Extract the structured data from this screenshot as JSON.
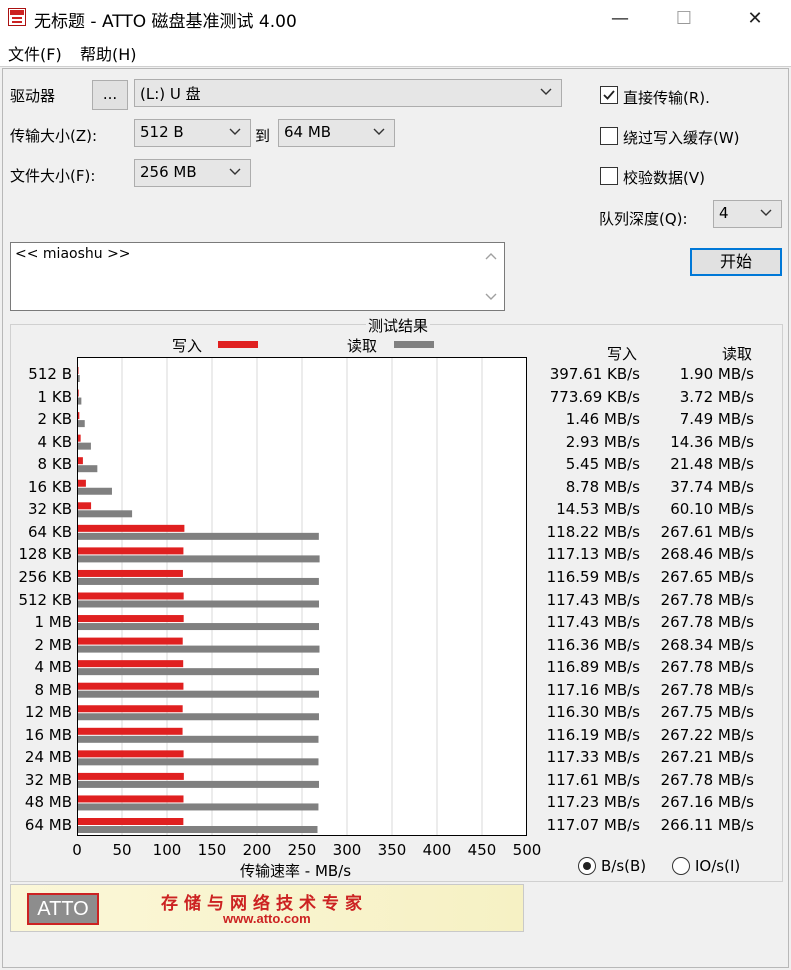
{
  "window": {
    "title": "无标题 - ATTO 磁盘基准测试 4.00",
    "minimize_glyph": "—",
    "maximize_glyph": "☐",
    "close_glyph": "✕"
  },
  "menu": {
    "file": "文件(F)",
    "help": "帮助(H)"
  },
  "drive": {
    "label": "驱动器",
    "browse_label": "...",
    "value": "(L:) U 盘"
  },
  "transfer": {
    "label": "传输大小(Z):",
    "from": "512 B",
    "to_label": "到",
    "to": "64 MB"
  },
  "filesize": {
    "label": "文件大小(F):",
    "value": "256 MB"
  },
  "options": {
    "direct": {
      "label": "直接传输(R).",
      "checked": true
    },
    "bypass": {
      "label": "绕过写入缓存(W)",
      "checked": false
    },
    "verify": {
      "label": "校验数据(V)",
      "checked": false
    },
    "queue_label": "队列深度(Q):",
    "queue_value": "4"
  },
  "start_button": "开始",
  "description": "<< miaoshu >>",
  "results": {
    "title": "测试结果",
    "legend_write": "写入",
    "legend_read": "读取",
    "col_write": "写入",
    "col_read": "读取",
    "units": {
      "bytes": "B/s(B)",
      "io": "IO/s(I)",
      "selected": "bytes"
    }
  },
  "chart_data": {
    "type": "bar",
    "orientation": "horizontal",
    "title": "测试结果",
    "xlabel": "传输速率 - MB/s",
    "ylabel": "",
    "xlim": [
      0,
      500
    ],
    "xticks": [
      0,
      50,
      100,
      150,
      200,
      250,
      300,
      350,
      400,
      450,
      500
    ],
    "grid": true,
    "legend": "top",
    "categories": [
      "512 B",
      "1 KB",
      "2 KB",
      "4 KB",
      "8 KB",
      "16 KB",
      "32 KB",
      "64 KB",
      "128 KB",
      "256 KB",
      "512 KB",
      "1 MB",
      "2 MB",
      "4 MB",
      "8 MB",
      "12 MB",
      "16 MB",
      "24 MB",
      "32 MB",
      "48 MB",
      "64 MB"
    ],
    "series": [
      {
        "name": "写入",
        "color": "#e02020",
        "values": [
          0.39,
          0.76,
          1.46,
          2.93,
          5.45,
          8.78,
          14.53,
          118.22,
          117.13,
          116.59,
          117.43,
          117.43,
          116.36,
          116.89,
          117.16,
          116.3,
          116.19,
          117.33,
          117.61,
          117.23,
          117.07
        ],
        "labels": [
          "397.61 KB/s",
          "773.69 KB/s",
          "1.46 MB/s",
          "2.93 MB/s",
          "5.45 MB/s",
          "8.78 MB/s",
          "14.53 MB/s",
          "118.22 MB/s",
          "117.13 MB/s",
          "116.59 MB/s",
          "117.43 MB/s",
          "117.43 MB/s",
          "116.36 MB/s",
          "116.89 MB/s",
          "117.16 MB/s",
          "116.30 MB/s",
          "116.19 MB/s",
          "117.33 MB/s",
          "117.61 MB/s",
          "117.23 MB/s",
          "117.07 MB/s"
        ]
      },
      {
        "name": "读取",
        "color": "#808080",
        "values": [
          1.9,
          3.72,
          7.49,
          14.36,
          21.48,
          37.74,
          60.1,
          267.61,
          268.46,
          267.65,
          267.78,
          267.78,
          268.34,
          267.78,
          267.78,
          267.75,
          267.22,
          267.21,
          267.78,
          267.16,
          266.11
        ],
        "labels": [
          "1.90 MB/s",
          "3.72 MB/s",
          "7.49 MB/s",
          "14.36 MB/s",
          "21.48 MB/s",
          "37.74 MB/s",
          "60.10 MB/s",
          "267.61 MB/s",
          "268.46 MB/s",
          "267.65 MB/s",
          "267.78 MB/s",
          "267.78 MB/s",
          "268.34 MB/s",
          "267.78 MB/s",
          "267.78 MB/s",
          "267.75 MB/s",
          "267.22 MB/s",
          "267.21 MB/s",
          "267.78 MB/s",
          "267.16 MB/s",
          "266.11 MB/s"
        ]
      }
    ]
  },
  "banner": {
    "logo": "ATTO",
    "tagline": "存储与网络技术专家",
    "url": "www.atto.com"
  }
}
